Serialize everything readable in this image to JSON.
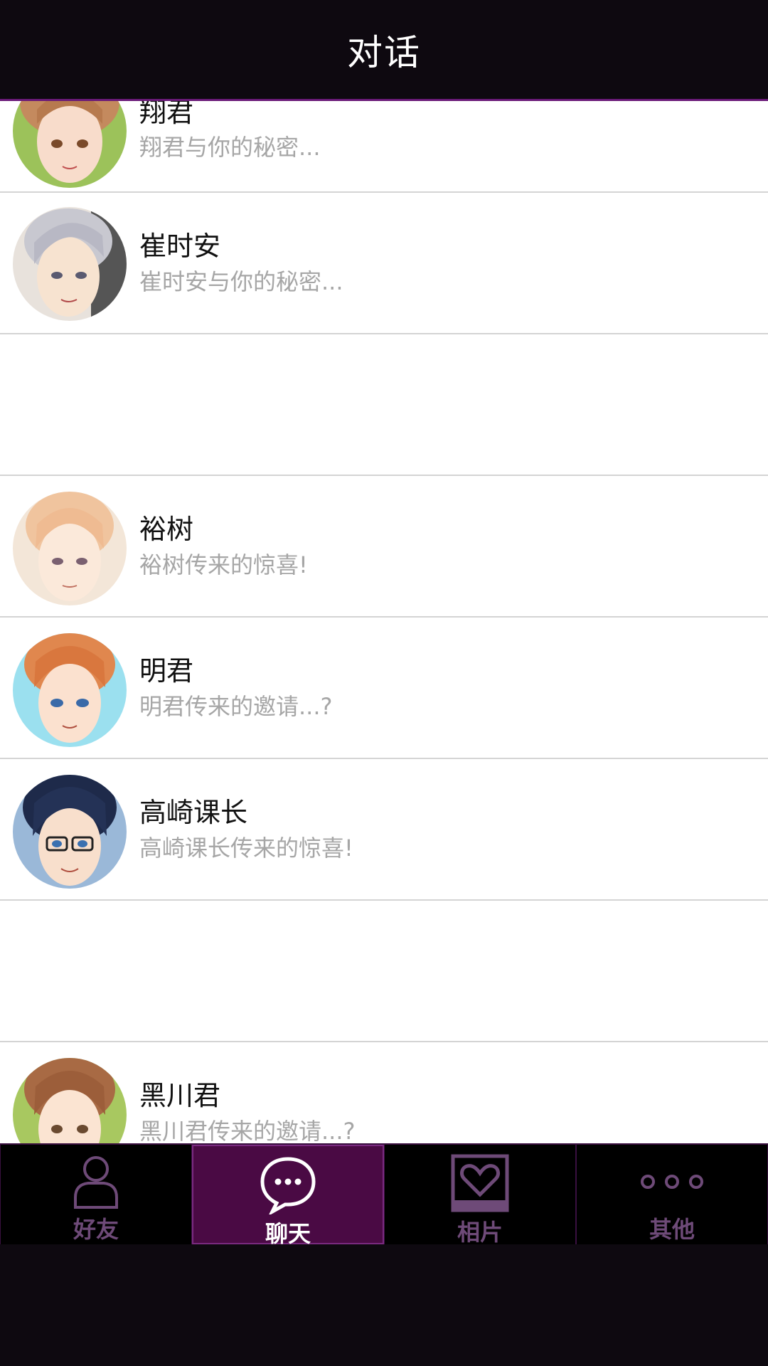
{
  "header": {
    "title": "对话"
  },
  "conversations": [
    {
      "name": "翔君",
      "preview": "翔君与你的秘密..."
    },
    {
      "name": "崔时安",
      "preview": "崔时安与你的秘密..."
    },
    {
      "name": "",
      "preview": ""
    },
    {
      "name": "裕树",
      "preview": "裕树传来的惊喜!"
    },
    {
      "name": "明君",
      "preview": "明君传来的邀请...?"
    },
    {
      "name": "高崎课长",
      "preview": "高崎课长传来的惊喜!"
    },
    {
      "name": "",
      "preview": ""
    },
    {
      "name": "黑川君",
      "preview": "黑川君传来的邀请...?"
    }
  ],
  "tabbar": {
    "tabs": [
      {
        "label": "好友",
        "icon": "friend-icon",
        "active": false
      },
      {
        "label": "聊天",
        "icon": "chat-bubble-icon",
        "active": true
      },
      {
        "label": "相片",
        "icon": "photo-heart-icon",
        "active": false
      },
      {
        "label": "其他",
        "icon": "more-dots-icon",
        "active": false
      }
    ]
  },
  "colors": {
    "accent": "#4a0a44",
    "header_bg": "#0e0910",
    "preview_text": "#a6a6a6"
  }
}
